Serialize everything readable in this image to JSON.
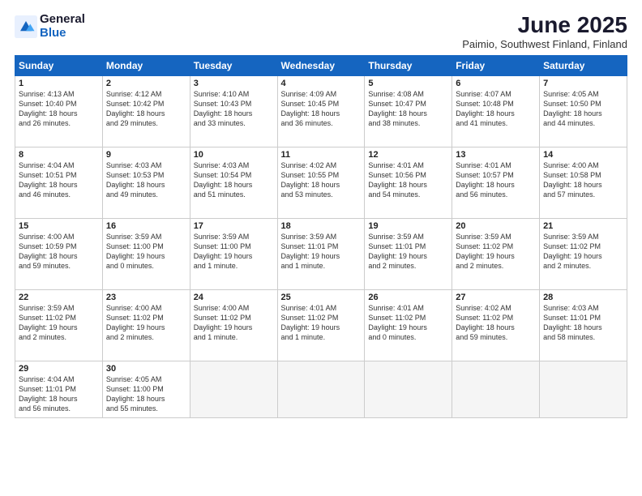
{
  "logo": {
    "general": "General",
    "blue": "Blue"
  },
  "title": "June 2025",
  "subtitle": "Paimio, Southwest Finland, Finland",
  "weekdays": [
    "Sunday",
    "Monday",
    "Tuesday",
    "Wednesday",
    "Thursday",
    "Friday",
    "Saturday"
  ],
  "weeks": [
    [
      {
        "day": "1",
        "info": "Sunrise: 4:13 AM\nSunset: 10:40 PM\nDaylight: 18 hours\nand 26 minutes."
      },
      {
        "day": "2",
        "info": "Sunrise: 4:12 AM\nSunset: 10:42 PM\nDaylight: 18 hours\nand 29 minutes."
      },
      {
        "day": "3",
        "info": "Sunrise: 4:10 AM\nSunset: 10:43 PM\nDaylight: 18 hours\nand 33 minutes."
      },
      {
        "day": "4",
        "info": "Sunrise: 4:09 AM\nSunset: 10:45 PM\nDaylight: 18 hours\nand 36 minutes."
      },
      {
        "day": "5",
        "info": "Sunrise: 4:08 AM\nSunset: 10:47 PM\nDaylight: 18 hours\nand 38 minutes."
      },
      {
        "day": "6",
        "info": "Sunrise: 4:07 AM\nSunset: 10:48 PM\nDaylight: 18 hours\nand 41 minutes."
      },
      {
        "day": "7",
        "info": "Sunrise: 4:05 AM\nSunset: 10:50 PM\nDaylight: 18 hours\nand 44 minutes."
      }
    ],
    [
      {
        "day": "8",
        "info": "Sunrise: 4:04 AM\nSunset: 10:51 PM\nDaylight: 18 hours\nand 46 minutes."
      },
      {
        "day": "9",
        "info": "Sunrise: 4:03 AM\nSunset: 10:53 PM\nDaylight: 18 hours\nand 49 minutes."
      },
      {
        "day": "10",
        "info": "Sunrise: 4:03 AM\nSunset: 10:54 PM\nDaylight: 18 hours\nand 51 minutes."
      },
      {
        "day": "11",
        "info": "Sunrise: 4:02 AM\nSunset: 10:55 PM\nDaylight: 18 hours\nand 53 minutes."
      },
      {
        "day": "12",
        "info": "Sunrise: 4:01 AM\nSunset: 10:56 PM\nDaylight: 18 hours\nand 54 minutes."
      },
      {
        "day": "13",
        "info": "Sunrise: 4:01 AM\nSunset: 10:57 PM\nDaylight: 18 hours\nand 56 minutes."
      },
      {
        "day": "14",
        "info": "Sunrise: 4:00 AM\nSunset: 10:58 PM\nDaylight: 18 hours\nand 57 minutes."
      }
    ],
    [
      {
        "day": "15",
        "info": "Sunrise: 4:00 AM\nSunset: 10:59 PM\nDaylight: 18 hours\nand 59 minutes."
      },
      {
        "day": "16",
        "info": "Sunrise: 3:59 AM\nSunset: 11:00 PM\nDaylight: 19 hours\nand 0 minutes."
      },
      {
        "day": "17",
        "info": "Sunrise: 3:59 AM\nSunset: 11:00 PM\nDaylight: 19 hours\nand 1 minute."
      },
      {
        "day": "18",
        "info": "Sunrise: 3:59 AM\nSunset: 11:01 PM\nDaylight: 19 hours\nand 1 minute."
      },
      {
        "day": "19",
        "info": "Sunrise: 3:59 AM\nSunset: 11:01 PM\nDaylight: 19 hours\nand 2 minutes."
      },
      {
        "day": "20",
        "info": "Sunrise: 3:59 AM\nSunset: 11:02 PM\nDaylight: 19 hours\nand 2 minutes."
      },
      {
        "day": "21",
        "info": "Sunrise: 3:59 AM\nSunset: 11:02 PM\nDaylight: 19 hours\nand 2 minutes."
      }
    ],
    [
      {
        "day": "22",
        "info": "Sunrise: 3:59 AM\nSunset: 11:02 PM\nDaylight: 19 hours\nand 2 minutes."
      },
      {
        "day": "23",
        "info": "Sunrise: 4:00 AM\nSunset: 11:02 PM\nDaylight: 19 hours\nand 2 minutes."
      },
      {
        "day": "24",
        "info": "Sunrise: 4:00 AM\nSunset: 11:02 PM\nDaylight: 19 hours\nand 1 minute."
      },
      {
        "day": "25",
        "info": "Sunrise: 4:01 AM\nSunset: 11:02 PM\nDaylight: 19 hours\nand 1 minute."
      },
      {
        "day": "26",
        "info": "Sunrise: 4:01 AM\nSunset: 11:02 PM\nDaylight: 19 hours\nand 0 minutes."
      },
      {
        "day": "27",
        "info": "Sunrise: 4:02 AM\nSunset: 11:02 PM\nDaylight: 18 hours\nand 59 minutes."
      },
      {
        "day": "28",
        "info": "Sunrise: 4:03 AM\nSunset: 11:01 PM\nDaylight: 18 hours\nand 58 minutes."
      }
    ],
    [
      {
        "day": "29",
        "info": "Sunrise: 4:04 AM\nSunset: 11:01 PM\nDaylight: 18 hours\nand 56 minutes."
      },
      {
        "day": "30",
        "info": "Sunrise: 4:05 AM\nSunset: 11:00 PM\nDaylight: 18 hours\nand 55 minutes."
      },
      null,
      null,
      null,
      null,
      null
    ]
  ]
}
